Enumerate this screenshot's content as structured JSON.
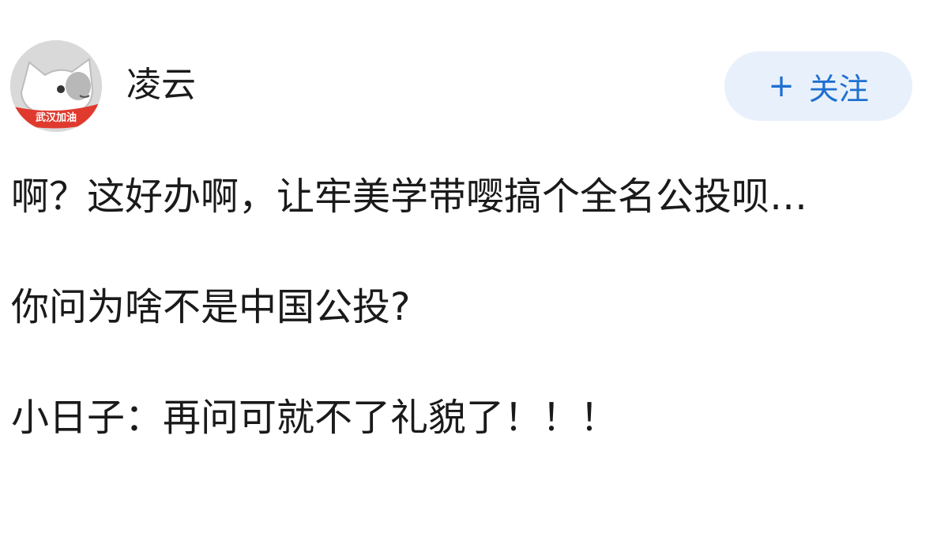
{
  "post": {
    "author": {
      "name": "凌云",
      "avatar": {
        "badge_text": "武汉加油",
        "badge_color": "#e03a2f",
        "bg_color": "#d8d8d8"
      }
    },
    "follow_button": {
      "plus": "+",
      "label": "关注",
      "text_color": "#1f6fd1",
      "bg_color": "#e8f1fb"
    },
    "paragraphs": [
      "啊？这好办啊，让牢美学带嘤搞个全名公投呗…",
      "你问为啥不是中国公投?",
      "小日子：再问可就不了礼貌了！！！"
    ]
  }
}
